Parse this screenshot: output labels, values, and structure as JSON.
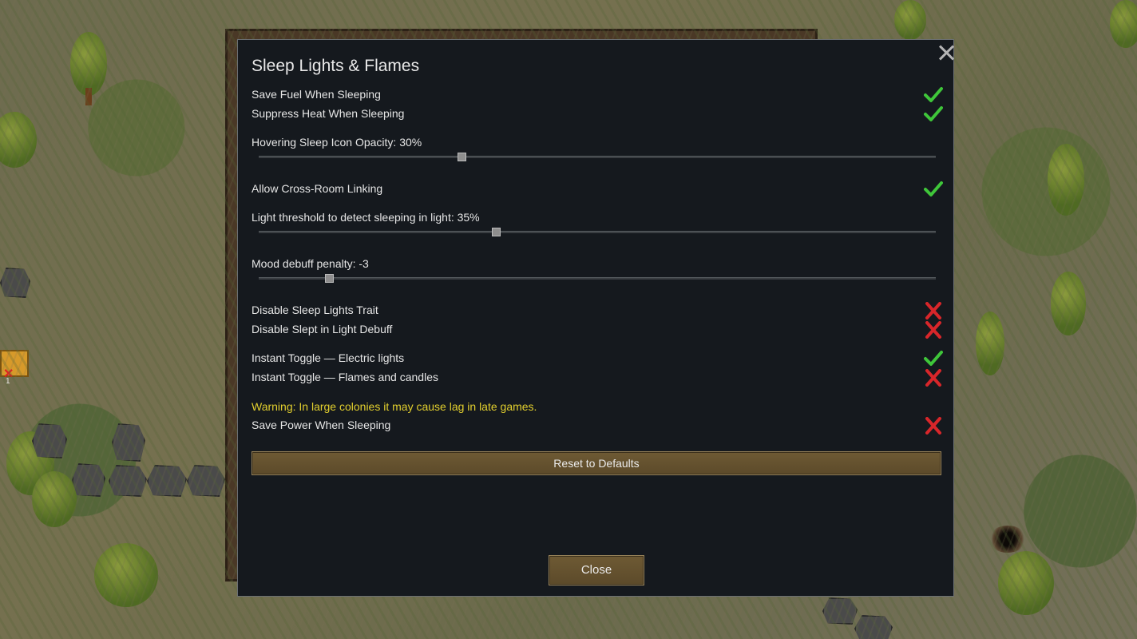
{
  "dialog": {
    "title": "Sleep Lights & Flames",
    "close_icon": "close-x-icon"
  },
  "settings": {
    "save_fuel": {
      "label": "Save Fuel When Sleeping",
      "value": true
    },
    "suppress_heat": {
      "label": "Suppress Heat When Sleeping",
      "value": true
    },
    "icon_opacity": {
      "label": "Hovering Sleep Icon Opacity: 30%",
      "value_percent": 30
    },
    "cross_room": {
      "label": "Allow Cross-Room Linking",
      "value": true
    },
    "light_threshold": {
      "label": "Light threshold to detect sleeping in light: 35%",
      "value_percent": 35
    },
    "mood_penalty": {
      "label": "Mood debuff penalty: -3",
      "value": -3,
      "slider_fraction": 0.104
    },
    "disable_trait": {
      "label": "Disable Sleep Lights Trait",
      "value": false
    },
    "disable_debuff": {
      "label": "Disable Slept in Light Debuff",
      "value": false
    },
    "instant_electric": {
      "label": "Instant Toggle — Electric lights",
      "value": true
    },
    "instant_flames": {
      "label": "Instant Toggle — Flames and candles",
      "value": false
    },
    "warning": "Warning: In large colonies it may cause lag in late games.",
    "save_power": {
      "label": "Save Power When Sleeping",
      "value": false
    }
  },
  "buttons": {
    "reset": "Reset to Defaults",
    "close": "Close"
  },
  "background": {
    "crate_count": "1"
  },
  "colors": {
    "check": "#3fc63a",
    "cross": "#d8262a",
    "warning": "#e2cf2e",
    "button": "#6e5a34",
    "panel": "#15191e"
  }
}
